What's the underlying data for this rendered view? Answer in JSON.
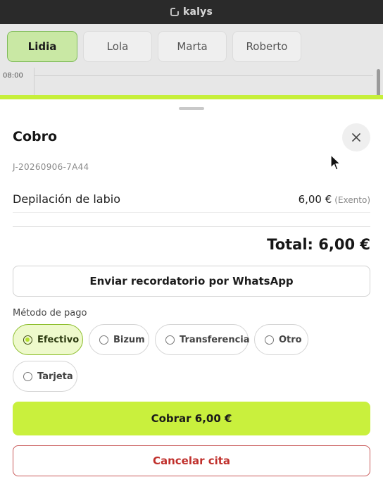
{
  "window": {
    "title": "kalys",
    "logo_icon": "app-logo-icon"
  },
  "calendar": {
    "staff": [
      {
        "label": "Lidia",
        "active": true
      },
      {
        "label": "Lola",
        "active": false
      },
      {
        "label": "Marta",
        "active": false
      },
      {
        "label": "Roberto",
        "active": false
      }
    ],
    "time_label": "08:00"
  },
  "sheet": {
    "title": "Cobro",
    "close_icon": "close-icon",
    "reference": "J-20260906-7A44",
    "items": [
      {
        "name": "Depilación de labio",
        "price": "6,00 €",
        "tax": "(Exento)"
      }
    ],
    "total": "Total: 6,00 €",
    "whatsapp_button": "Enviar recordatorio por WhatsApp",
    "payment_method_label": "Método de pago",
    "payment_methods": [
      {
        "label": "Efectivo",
        "selected": true
      },
      {
        "label": "Bizum",
        "selected": false
      },
      {
        "label": "Transferencia",
        "selected": false
      },
      {
        "label": "Otro",
        "selected": false
      },
      {
        "label": "Tarjeta",
        "selected": false
      }
    ],
    "pay_button": "Cobrar 6,00 €",
    "cancel_button": "Cancelar cita"
  },
  "colors": {
    "accent": "#c9f03d",
    "danger": "#c0302c",
    "selected_bg": "#eef9cc"
  }
}
